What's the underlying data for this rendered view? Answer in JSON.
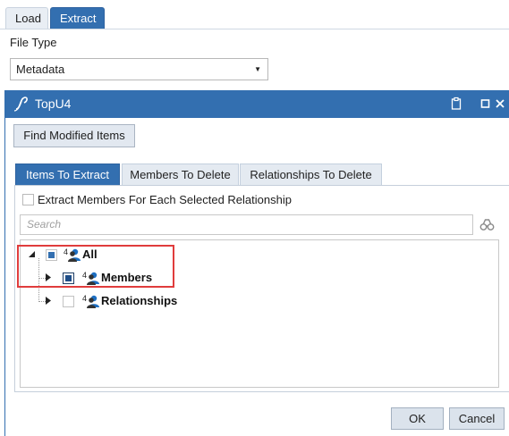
{
  "top_tabs": [
    {
      "label": "Load",
      "active": false
    },
    {
      "label": "Extract",
      "active": true
    }
  ],
  "file_type": {
    "label": "File Type",
    "selected": "Metadata"
  },
  "dialog": {
    "title": "TopU4",
    "find_button": "Find Modified Items",
    "tabs": [
      {
        "label": "Items To Extract",
        "active": true
      },
      {
        "label": "Members To Delete",
        "active": false
      },
      {
        "label": "Relationships To Delete",
        "active": false
      }
    ],
    "extract_members_option": {
      "label": "Extract Members For Each Selected Relationship",
      "checked": false
    },
    "search": {
      "placeholder": "Search"
    },
    "tree": [
      {
        "label": "All",
        "badge": "4",
        "expanded": true,
        "state": "partial"
      },
      {
        "label": "Members",
        "badge": "4",
        "expanded": false,
        "state": "partial",
        "highlighted": true
      },
      {
        "label": "Relationships",
        "badge": "4",
        "expanded": false,
        "state": "unchecked"
      }
    ],
    "ok_button": "OK",
    "cancel_button": "Cancel"
  },
  "colors": {
    "accent": "#336fb0",
    "highlight_border": "#e03c3c"
  }
}
